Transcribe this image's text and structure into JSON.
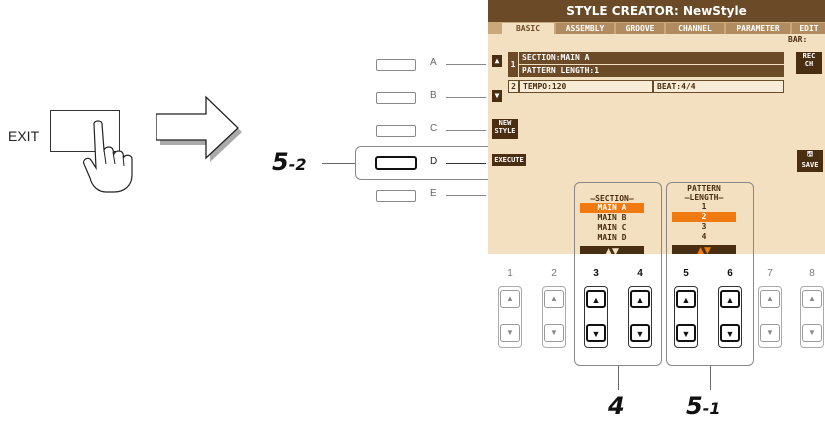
{
  "exit": {
    "label": "EXIT"
  },
  "panel_buttons": [
    {
      "letter": "A"
    },
    {
      "letter": "B"
    },
    {
      "letter": "C"
    },
    {
      "letter": "D"
    },
    {
      "letter": "E"
    }
  ],
  "callouts": {
    "step_5_2": {
      "main": "5",
      "sub": "-2"
    },
    "step_4": {
      "main": "4"
    },
    "step_5_1": {
      "main": "5",
      "sub": "-1"
    }
  },
  "screen": {
    "title": "STYLE CREATOR: NewStyle",
    "tabs": [
      "BASIC",
      "ASSEMBLY",
      "GROOVE",
      "CHANNEL",
      "PARAMETER",
      "EDIT"
    ],
    "active_tab": "BASIC",
    "bar_label": "BAR:",
    "row1_num": "1",
    "row1_section": "SECTION:MAIN A",
    "row1_pattern": "PATTERN LENGTH:1",
    "row2_num": "2",
    "row2_tempo": "TEMPO:120",
    "row2_beat": "BEAT:4/4",
    "rec_ch": [
      "REC",
      "CH"
    ],
    "new_style": [
      "NEW",
      "STYLE"
    ],
    "execute": "EXECUTE",
    "save": "SAVE",
    "section_list": {
      "header": "SECTION",
      "items": [
        "MAIN A",
        "MAIN B",
        "MAIN C",
        "MAIN D"
      ],
      "selected_index": 0
    },
    "pattern_list": {
      "header_line1": "PATTERN",
      "header_line2": "LENGTH",
      "items": [
        "1",
        "2",
        "3",
        "4"
      ],
      "selected_index": 1
    },
    "arrows": "▲▼"
  },
  "bottom_buttons": [
    "1",
    "2",
    "3",
    "4",
    "5",
    "6",
    "7",
    "8"
  ],
  "colors": {
    "screen_bg": "#f3e0c0",
    "screen_dark": "#6b4a28",
    "highlight": "#f07a10"
  }
}
